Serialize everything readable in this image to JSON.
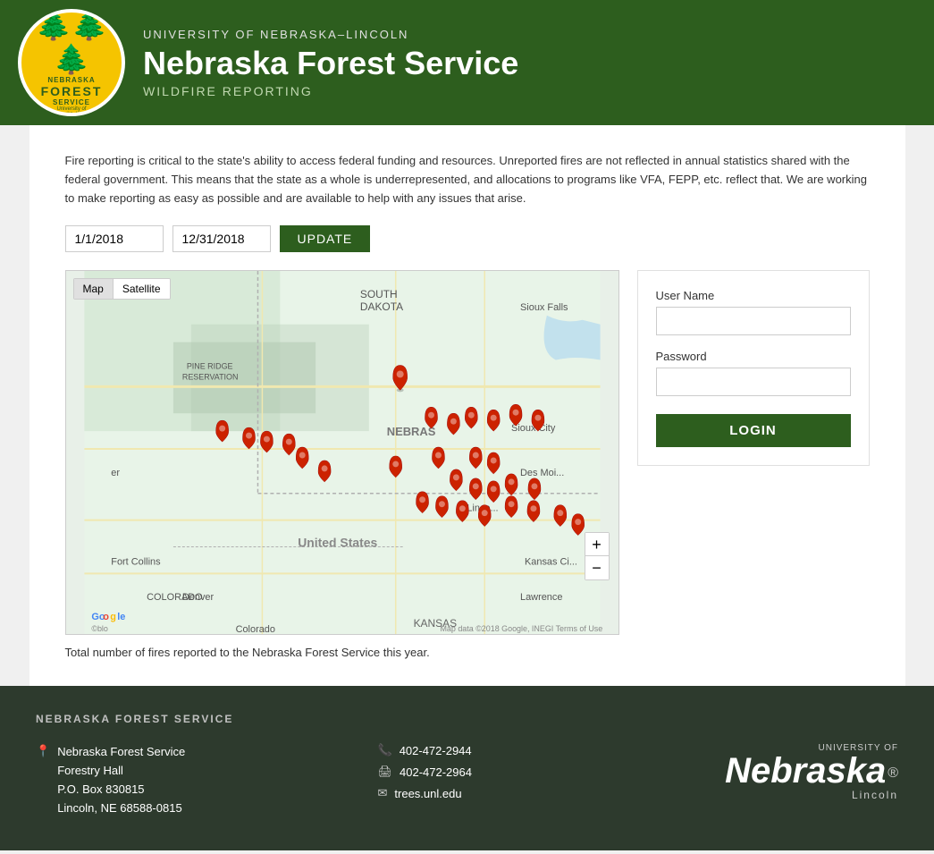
{
  "header": {
    "university": "UNIVERSITY OF NEBRASKA–LINCOLN",
    "title": "Nebraska Forest Service",
    "subtitle": "WILDFIRE REPORTING",
    "logo_trees": "🌲",
    "logo_nebraska": "NEBRASKA",
    "logo_forest": "FOREST",
    "logo_service": "SERVICE",
    "logo_unl": "University of\nNebraska–Lincoln"
  },
  "description": "Fire reporting is critical to the state's ability to access federal funding and resources. Unreported fires are not reflected in annual statistics shared with the federal government. This means that the state as a whole is underrepresented, and allocations to programs like VFA, FEPP, etc. reflect that. We are working to make reporting as easy as possible and are available to help with any issues that arise.",
  "dateControls": {
    "startDate": "1/1/2018",
    "endDate": "12/31/2018",
    "updateLabel": "UPDATE"
  },
  "map": {
    "tab_map": "Map",
    "tab_satellite": "Satellite",
    "zoom_in": "+",
    "zoom_out": "−",
    "footer": "Map data ©2018 Google, INEGI   Terms of Use",
    "google_logo": "Google"
  },
  "login": {
    "username_label": "User Name",
    "username_placeholder": "",
    "password_label": "Password",
    "password_placeholder": "",
    "login_button": "LOGIN"
  },
  "totalFires": "Total number of fires reported to the Nebraska Forest Service this year.",
  "footer": {
    "section_title": "NEBRASKA FOREST SERVICE",
    "org_name": "Nebraska Forest Service",
    "address_line1": "Forestry Hall",
    "address_line2": "P.O. Box 830815",
    "address_line3": "Lincoln, NE 68588-0815",
    "phone1": "402-472-2944",
    "phone2": "402-472-2964",
    "email": "trees.unl.edu",
    "unl_logo_top": "UNIVERSITY OF",
    "unl_logo_main": "Nebraska",
    "unl_logo_bottom": "Lincoln"
  }
}
